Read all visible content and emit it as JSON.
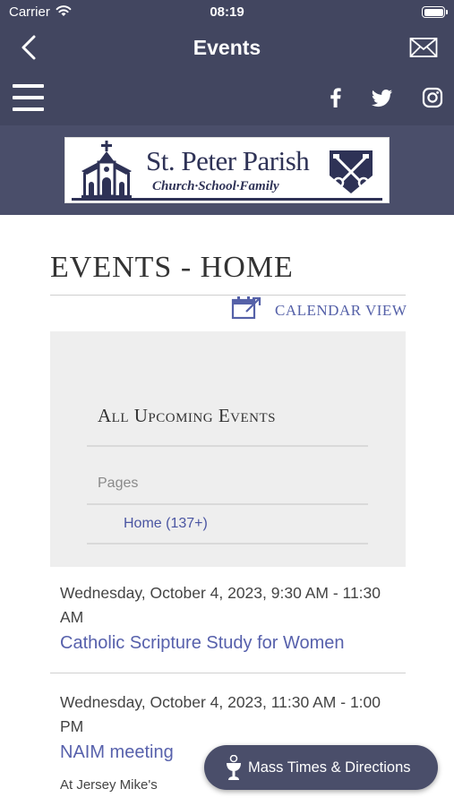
{
  "status_bar": {
    "carrier": "Carrier",
    "time": "08:19"
  },
  "nav": {
    "title": "Events"
  },
  "logo": {
    "title": "St. Peter Parish",
    "subtitle": "Church·School·Family"
  },
  "content": {
    "heading": "EVENTS - HOME",
    "calendar_link": "CALENDAR VIEW",
    "filter": {
      "title": "All Upcoming Events",
      "pages_label": "Pages",
      "home_link": "Home (137+)"
    },
    "events": [
      {
        "date": "Wednesday, October 4, 2023, 9:30 AM - 11:30 AM",
        "title": "Catholic Scripture Study for Women"
      },
      {
        "date": "Wednesday, October 4, 2023, 11:30 AM - 1:00 PM",
        "title": "NAIM meeting",
        "location": "At Jersey Mike's"
      }
    ]
  },
  "fab": {
    "label": "Mass Times & Directions"
  },
  "colors": {
    "header": "#424660",
    "banner": "#4a4e6a",
    "link": "#5761ac"
  }
}
